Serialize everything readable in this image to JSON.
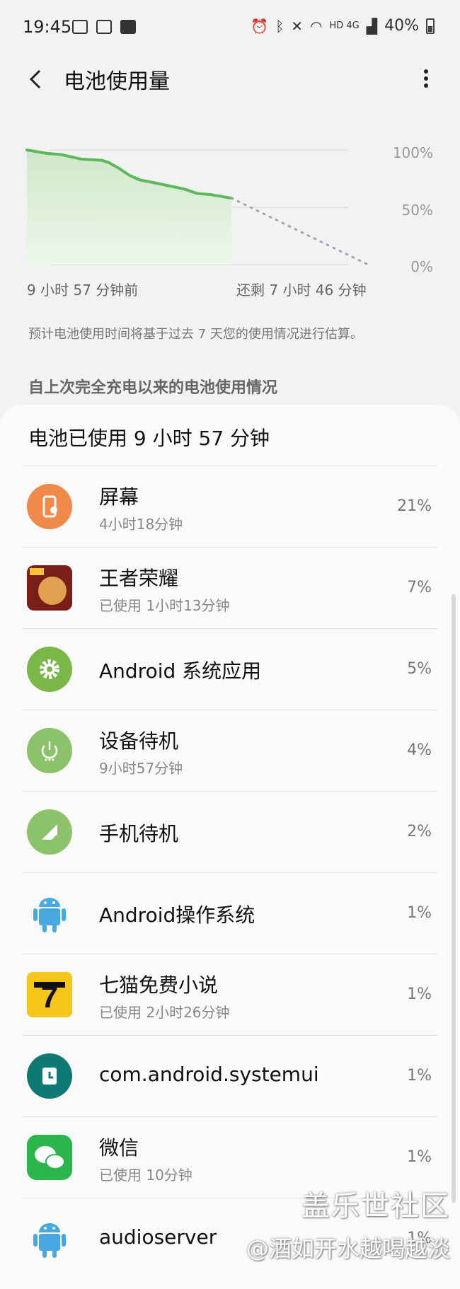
{
  "status_bar": {
    "time": "19:45",
    "network": "HD 4G",
    "battery": "40%"
  },
  "header": {
    "title": "电池使用量"
  },
  "chart_data": {
    "type": "line",
    "y_ticks": [
      "100%",
      "50%",
      "0%"
    ],
    "x_start_label": "9 小时 57 分钟前",
    "x_end_label": "还剩 7 小时 46 分钟",
    "ylim": [
      0,
      100
    ],
    "series": [
      {
        "points": [
          [
            0,
            100
          ],
          [
            0.06,
            97
          ],
          [
            0.1,
            96
          ],
          [
            0.16,
            92
          ],
          [
            0.22,
            91
          ],
          [
            0.24,
            89
          ],
          [
            0.27,
            84
          ],
          [
            0.3,
            78
          ],
          [
            0.33,
            74
          ],
          [
            0.38,
            71
          ],
          [
            0.46,
            66
          ],
          [
            0.5,
            62
          ],
          [
            0.54,
            61
          ],
          [
            0.6,
            58
          ]
        ],
        "style": "solid",
        "color": "#5cb85c"
      },
      {
        "points": [
          [
            0.6,
            58
          ],
          [
            1.0,
            0
          ]
        ],
        "style": "dotted",
        "color": "#9aa7b5"
      }
    ]
  },
  "note": "预计电池使用时间将基于过去 7 天您的使用情况进行估算。",
  "section_header": "自上次完全充电以来的电池使用情况",
  "card": {
    "title": "电池已使用 9 小时 57 分钟",
    "items": [
      {
        "name": "屏幕",
        "sub": "4小时18分钟",
        "value": "21%",
        "icon": "screen-icon",
        "color": "#ef8a4a"
      },
      {
        "name": "王者荣耀",
        "sub": "已使用 1小时13分钟",
        "value": "7%",
        "icon": "game-app-icon",
        "color": "#b5312a"
      },
      {
        "name": "Android 系统应用",
        "sub": "",
        "value": "5%",
        "icon": "gear-icon",
        "color": "#7ab648"
      },
      {
        "name": "设备待机",
        "sub": "9小时57分钟",
        "value": "4%",
        "icon": "power-icon",
        "color": "#8cc36a"
      },
      {
        "name": "手机待机",
        "sub": "",
        "value": "2%",
        "icon": "signal-icon",
        "color": "#8cc36a"
      },
      {
        "name": "Android操作系统",
        "sub": "",
        "value": "1%",
        "icon": "android-icon",
        "color": "#4aa8e0"
      },
      {
        "name": "七猫免费小说",
        "sub": "已使用 2小时26分钟",
        "value": "1%",
        "icon": "novel-app-icon",
        "color": "#f5c518"
      },
      {
        "name": "com.android.systemui",
        "sub": "",
        "value": "1%",
        "icon": "clock-icon",
        "color": "#0f7a73"
      },
      {
        "name": "微信",
        "sub": "已使用 10分钟",
        "value": "1%",
        "icon": "wechat-icon",
        "color": "#2bb64b"
      },
      {
        "name": "audioserver",
        "sub": "",
        "value": "1%",
        "icon": "android-icon",
        "color": "#4aa8e0"
      }
    ]
  },
  "watermark": {
    "line1": "盖乐世社区",
    "line2": "@酒如开水越喝越淡"
  }
}
